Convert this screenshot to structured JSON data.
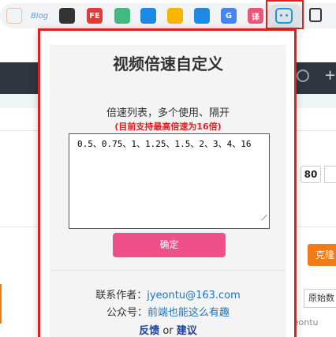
{
  "toolbar": {
    "extensions": [
      {
        "name": "bookmark-ext-icon",
        "color": "#f2f3f5",
        "text": ""
      },
      {
        "name": "blog-ext-icon",
        "color": "#f2f3f5",
        "text": "Blog"
      },
      {
        "name": "window-ext-icon",
        "color": "#333333",
        "text": ""
      },
      {
        "name": "fe-ext-icon",
        "color": "#e53935",
        "text": "FE"
      },
      {
        "name": "vue-ext-icon",
        "color": "#42b883",
        "text": ""
      },
      {
        "name": "swirl-ext-icon",
        "color": "#1e88e5",
        "text": ""
      },
      {
        "name": "emoji-ext-icon",
        "color": "#f7b500",
        "text": ""
      },
      {
        "name": "layers-ext-icon",
        "color": "#1e88e5",
        "text": ""
      },
      {
        "name": "g-ext-icon",
        "color": "#4285f4",
        "text": "G"
      },
      {
        "name": "translate-ext-icon",
        "color": "#e8577a",
        "text": "译"
      }
    ]
  },
  "page": {
    "value_80": "80",
    "orange_button": "克隆",
    "select_value": "原始数",
    "watermark": "知乎 @Yeontu"
  },
  "popup": {
    "title": "视频倍速自定义",
    "subtitle": "倍速列表，多个使用、隔开",
    "hint": "(目前支持最高倍速为16倍)",
    "speeds_value": "0.5、0.75、1、1.25、1.5、2、3、4、16",
    "confirm_label": "确定",
    "author_label": "联系作者：",
    "author_email": "jyeontu@163.com",
    "wechat_label": "公众号：",
    "wechat_name": "前端也能这么有趣",
    "feedback": "反馈",
    "or": "or",
    "suggest": "建议"
  },
  "colors": {
    "accent_red": "#e02020",
    "confirm_pink": "#f0508a",
    "link_blue": "#1a73c8"
  }
}
